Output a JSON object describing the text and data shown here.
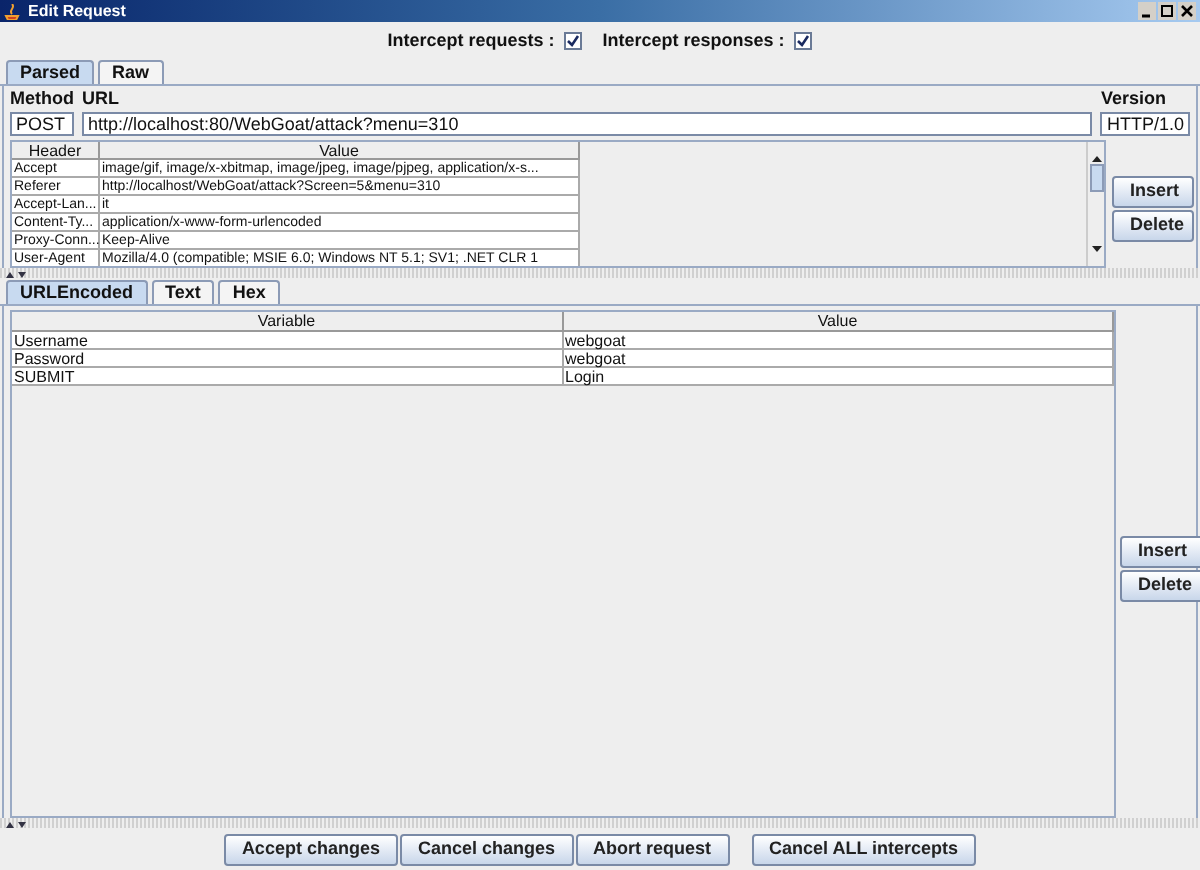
{
  "window": {
    "title": "Edit Request"
  },
  "intercept": [
    {
      "label": "Intercept requests :",
      "checked": true
    },
    {
      "label": "Intercept responses :",
      "checked": true
    }
  ],
  "request_tabs": [
    {
      "label": "Parsed",
      "selected": true
    },
    {
      "label": "Raw",
      "selected": false
    }
  ],
  "method": {
    "label": "Method",
    "value": "POST"
  },
  "url": {
    "label": "URL",
    "value": "http://localhost:80/WebGoat/attack?menu=310"
  },
  "version": {
    "label": "Version",
    "value": "HTTP/1.0"
  },
  "headers_table": {
    "columns": [
      "Header",
      "Value"
    ],
    "rows": [
      [
        "Accept",
        "image/gif, image/x-xbitmap, image/jpeg, image/pjpeg, application/x-s..."
      ],
      [
        "Referer",
        "http://localhost/WebGoat/attack?Screen=5&menu=310"
      ],
      [
        "Accept-Lan...",
        "it"
      ],
      [
        "Content-Ty...",
        "application/x-www-form-urlencoded"
      ],
      [
        "Proxy-Conn...",
        "Keep-Alive"
      ],
      [
        "User-Agent",
        "Mozilla/4.0 (compatible; MSIE 6.0; Windows NT 5.1; SV1; .NET CLR 1"
      ]
    ]
  },
  "header_buttons": [
    "Insert",
    "Delete"
  ],
  "body_tabs": [
    {
      "label": "URLEncoded",
      "selected": true
    },
    {
      "label": "Text",
      "selected": false
    },
    {
      "label": "Hex",
      "selected": false
    }
  ],
  "params_table": {
    "columns": [
      "Variable",
      "Value"
    ],
    "rows": [
      [
        "Username",
        "webgoat"
      ],
      [
        "Password",
        "webgoat"
      ],
      [
        "SUBMIT",
        "Login"
      ]
    ]
  },
  "param_buttons": [
    "Insert",
    "Delete"
  ],
  "footer_buttons": [
    "Accept changes",
    "Cancel changes",
    "Abort request",
    "Cancel ALL intercepts"
  ]
}
